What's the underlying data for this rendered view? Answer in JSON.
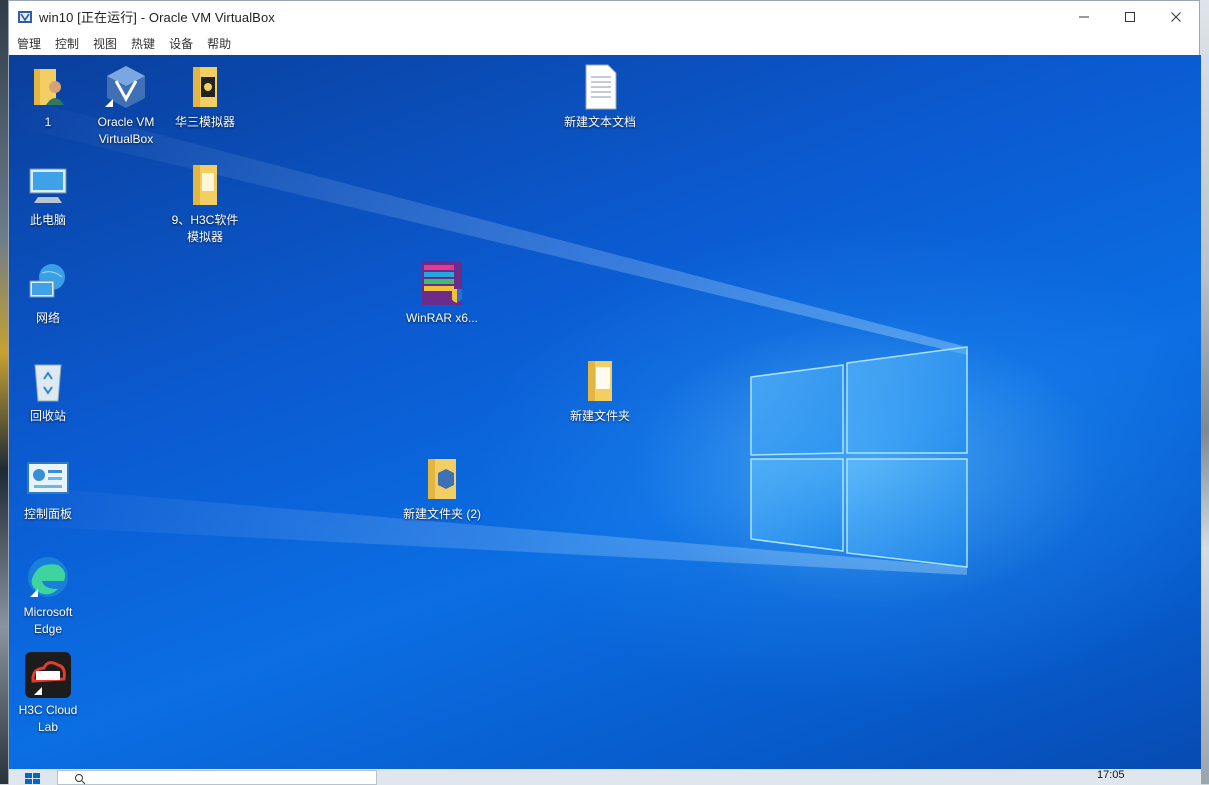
{
  "window": {
    "title": "win10 [正在运行] - Oracle VM VirtualBox"
  },
  "menu": [
    "管理",
    "控制",
    "视图",
    "热键",
    "设备",
    "帮助"
  ],
  "desktop_icons": [
    {
      "label": "1",
      "icon": "user-folder-icon"
    },
    {
      "label": "Oracle VM VirtualBox",
      "icon": "virtualbox-icon"
    },
    {
      "label": "华三模拟器",
      "icon": "folder-icon"
    },
    {
      "label": "新建文本文档",
      "icon": "text-document-icon"
    },
    {
      "label": "此电脑",
      "icon": "computer-icon"
    },
    {
      "label": "9、H3C软件模拟器",
      "icon": "folder-icon"
    },
    {
      "label": "网络",
      "icon": "network-icon"
    },
    {
      "label": "WinRAR x6...",
      "icon": "winrar-icon"
    },
    {
      "label": "回收站",
      "icon": "recycle-bin-icon"
    },
    {
      "label": "新建文件夹",
      "icon": "folder-icon"
    },
    {
      "label": "控制面板",
      "icon": "control-panel-icon"
    },
    {
      "label": "新建文件夹 (2)",
      "icon": "virtualbox-folder-icon"
    },
    {
      "label": "Microsoft Edge",
      "icon": "edge-icon"
    },
    {
      "label": "H3C Cloud Lab",
      "icon": "hcl-icon"
    }
  ],
  "taskbar": {
    "clock": "17:05"
  },
  "colors": {
    "desktop_blue": "#0b6ee3",
    "windows_logo": "#8fd8ff"
  }
}
